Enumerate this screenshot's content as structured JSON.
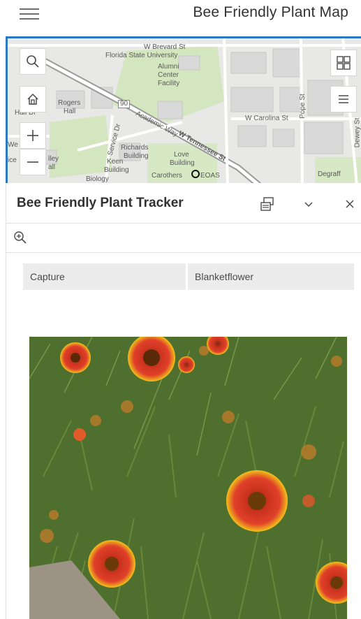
{
  "app": {
    "title": "Bee Friendly Plant Map"
  },
  "map": {
    "labels": {
      "brevard": "W Brevard St",
      "fsu": "Florida State University",
      "alumni": "Alumni",
      "center": "Center",
      "facility": "Facility",
      "rogers": "Rogers",
      "hall": "Hall",
      "hall_dr": "Hall Dr",
      "route": "90",
      "academic": "Academic Way",
      "tennessee": "W Tennessee St",
      "service": "Service Dr",
      "carolina": "W Carolina St",
      "pope": "Pope St",
      "richards": "Richards",
      "building": "Building",
      "love": "Love",
      "love_building": "Building",
      "keen": "Keen",
      "keen_building": "Building",
      "biology": "Biology",
      "carothers": "Carothers",
      "eoas": "EOAS",
      "degraff": "Degraff",
      "dewey": "Dewey St",
      "we": "We",
      "ice": "ice",
      "ley": "lley",
      "all": "all"
    },
    "controls": {
      "search": "search-icon",
      "home": "home-icon",
      "zoom_in": "plus-icon",
      "zoom_out": "minus-icon",
      "basemap": "basemap-gallery-icon",
      "layers": "layer-list-icon"
    }
  },
  "panel": {
    "title": "Bee Friendly Plant Tracker",
    "icons": {
      "dock": "dock-icon",
      "collapse": "chevron-down-icon",
      "close": "close-icon",
      "zoom": "zoom-to-icon"
    },
    "attributes": [
      {
        "key": "Capture",
        "value": "Blanketflower"
      }
    ]
  },
  "colors": {
    "accent": "#2b79c2",
    "map_bg": "#eaeaea",
    "park": "#cfe3b8",
    "road": "#ffffff"
  }
}
